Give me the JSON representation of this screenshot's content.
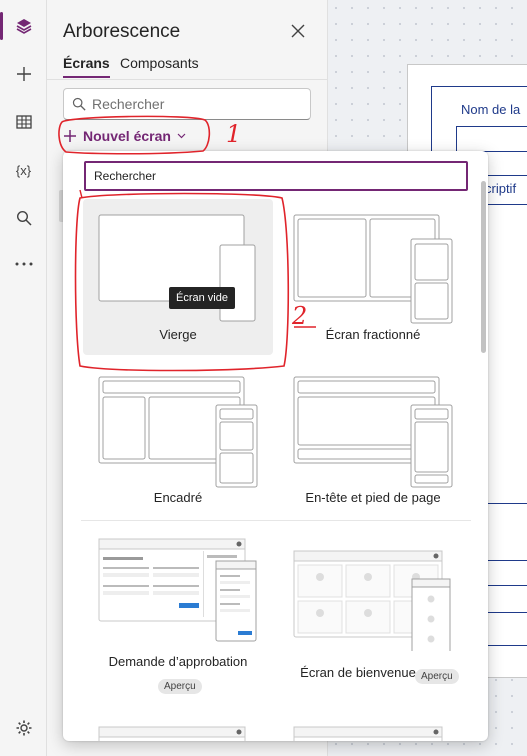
{
  "rail": {
    "items": [
      {
        "name": "layers-icon",
        "active": true
      },
      {
        "name": "plus-icon",
        "active": false
      },
      {
        "name": "table-icon",
        "active": false
      },
      {
        "name": "variables-icon",
        "label": "{x}",
        "active": false
      },
      {
        "name": "search-icon",
        "active": false
      },
      {
        "name": "more-icon",
        "active": false
      }
    ],
    "settings_icon": "gear-icon"
  },
  "panel": {
    "title": "Arborescence",
    "tabs": [
      {
        "label": "Écrans",
        "active": true
      },
      {
        "label": "Composants",
        "active": false
      }
    ],
    "search_placeholder": "Rechercher",
    "new_screen_label": "Nouvel écran"
  },
  "flyout": {
    "search_value": "Rechercher",
    "tooltip": "Écran vide",
    "templates": [
      {
        "label": "Vierge",
        "selected": true
      },
      {
        "label": "Écran fractionné"
      },
      {
        "label": "Encadré"
      },
      {
        "label": "En-tête et pied de page"
      },
      {
        "label": "Demande d’approbation",
        "badge": "Aperçu"
      },
      {
        "label": "Écran de bienvenue",
        "badge": "Aperçu"
      }
    ]
  },
  "canvas": {
    "field_label": "Nom de la",
    "field_label2": "criptif"
  },
  "annotations": {
    "mark1": "1",
    "mark2": "2"
  },
  "colors": {
    "accent": "#742774",
    "annotation": "#e0242b",
    "canvas_border": "#1f3a8a"
  }
}
